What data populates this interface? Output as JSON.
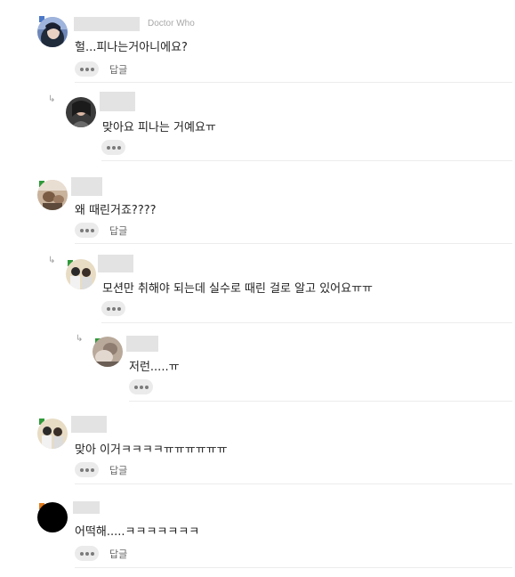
{
  "comments": [
    {
      "text": "헐...피나는거아니에요?",
      "tag": "Doctor Who",
      "reply_label": "답글"
    },
    {
      "text": "맞아요 피나는 거예요ㅠ",
      "reply_label": ""
    },
    {
      "text": "왜 때린거죠????",
      "reply_label": "답글"
    },
    {
      "text": "모션만 취해야 되는데 실수로 때린 걸로 알고 있어요ㅠㅠ",
      "reply_label": ""
    },
    {
      "text": "저런.....ㅠ",
      "reply_label": ""
    },
    {
      "text": "맞아 이거ㅋㅋㅋㅋㅠㅠㅠㅠㅠㅠ",
      "reply_label": "답글"
    },
    {
      "text": "어떡해.....ㅋㅋㅋㅋㅋㅋㅋ",
      "reply_label": "답글"
    }
  ],
  "reply_arrow": "↳",
  "icons": {
    "more": "more-dots-icon",
    "reply_arrow": "reply-arrow-icon",
    "level_badge": "level-badge-icon"
  }
}
